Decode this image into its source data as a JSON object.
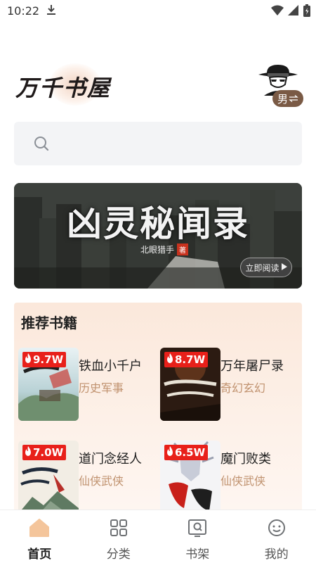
{
  "status_bar": {
    "time": "10:22"
  },
  "header": {
    "logo_text": "万千书屋",
    "gender_label": "男"
  },
  "banner": {
    "title": "凶灵秘闻录",
    "author": "北眼猎手",
    "author_tag": "著",
    "read_button": "立即阅读"
  },
  "recommend": {
    "title": "推荐书籍",
    "books": [
      {
        "title": "铁血小千户",
        "genre": "历史军事",
        "heat": "9.7W"
      },
      {
        "title": "万年屠尸录",
        "genre": "奇幻玄幻",
        "heat": "8.7W"
      },
      {
        "title": "道门念经人",
        "genre": "仙侠武侠",
        "heat": "7.0W"
      },
      {
        "title": "魔门败类",
        "genre": "仙侠武侠",
        "heat": "6.5W"
      }
    ]
  },
  "nav": {
    "items": [
      {
        "label": "首页",
        "icon": "home-icon",
        "active": true
      },
      {
        "label": "分类",
        "icon": "grid-icon",
        "active": false
      },
      {
        "label": "书架",
        "icon": "bookshelf-icon",
        "active": false
      },
      {
        "label": "我的",
        "icon": "profile-icon",
        "active": false
      }
    ]
  },
  "colors": {
    "accent": "#f4c59b",
    "genre": "#c0926f",
    "badge": "#e8201a",
    "pill": "#7a5a45"
  }
}
